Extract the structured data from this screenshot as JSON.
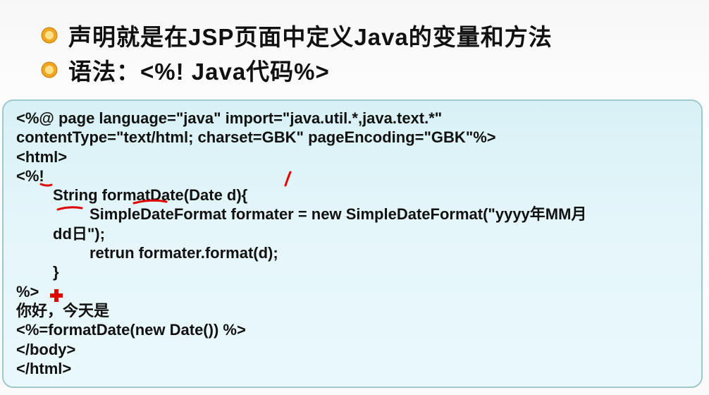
{
  "bullets": [
    {
      "icon": "ring-bullet-icon",
      "text": "声明就是在JSP页面中定义Java的变量和方法"
    },
    {
      "icon": "ring-bullet-icon",
      "text": "语法：<%! Java代码%>"
    }
  ],
  "code_lines": [
    "<%@ page language=\"java\" import=\"java.util.*,java.text.*\"",
    "contentType=\"text/html; charset=GBK\" pageEncoding=\"GBK\"%>",
    "<html>",
    "<%!",
    "String formatDate(Date d){",
    "SimpleDateFormat formater = new SimpleDateFormat(\"yyyy年MM月",
    "dd日\");",
    "retrun formater.format(d);",
    "}",
    "%>",
    "你好，今天是",
    "<%=formatDate(new Date()) %>",
    "</body>",
    "</html>"
  ],
  "colors": {
    "bullet_outer": "#f2a521",
    "bullet_inner": "#ffe28a",
    "box_border": "#9ec9cc",
    "box_fill": "#dff4f8",
    "annotation_red": "#e00000"
  }
}
